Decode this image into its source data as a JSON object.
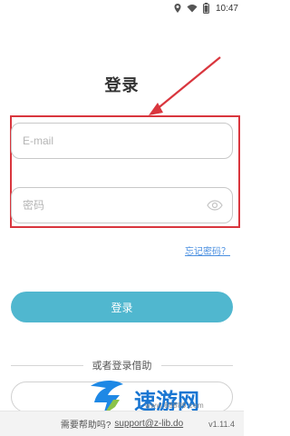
{
  "status_bar": {
    "time": "10:47",
    "icons": [
      "location-icon",
      "wifi-icon",
      "battery-icon"
    ]
  },
  "login": {
    "title": "登录",
    "email_placeholder": "E-mail",
    "password_placeholder": "密码",
    "forgot_password": "忘记密码？",
    "login_button": "登录",
    "or_login_with": "或者登录借助"
  },
  "footer": {
    "help_text": "需要帮助吗?",
    "support_email": "support@z-lib.do",
    "version": "v1.11.4"
  },
  "watermark": {
    "brand": "速游网",
    "site": "www.88889.com"
  },
  "annotations": {
    "highlight_color": "#d9363e",
    "arrow_color": "#d9363e"
  },
  "theme": {
    "primary_button": "#50b7cf",
    "link": "#4a8fe0"
  }
}
